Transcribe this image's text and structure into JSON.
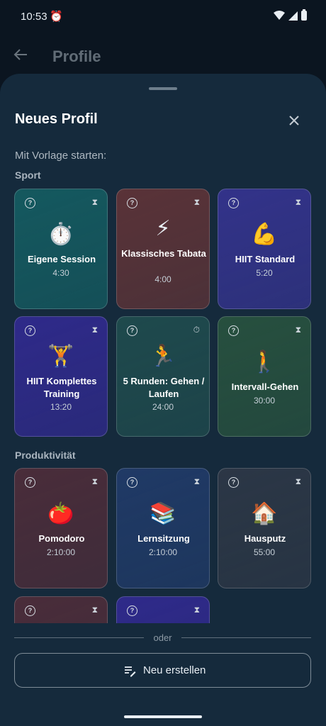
{
  "status": {
    "time": "10:53",
    "alarm_icon": "alarm-icon"
  },
  "appbar": {
    "title": "Profile"
  },
  "sheet": {
    "title": "Neues Profil",
    "subtitle": "Mit Vorlage starten:",
    "sections": [
      "Sport",
      "Produktivität"
    ]
  },
  "sport": [
    {
      "emoji": "⏱️",
      "name": "Eigene Session",
      "duration": "4:30",
      "color": "#15595f",
      "indicator": "hourglass"
    },
    {
      "emoji": "⚡",
      "name": "Klassisches Tabata",
      "duration": "4:00",
      "color": "#5a3338",
      "indicator": "hourglass"
    },
    {
      "emoji": "💪",
      "name": "HIIT Standard",
      "duration": "5:20",
      "color": "#33338a",
      "indicator": "hourglass"
    },
    {
      "emoji": "🏋️",
      "name": "HIIT Komplettes Training",
      "duration": "13:20",
      "color": "#2f2a8a",
      "indicator": "hourglass"
    },
    {
      "emoji": "🏃",
      "name": "5 Runden: Gehen / Laufen",
      "duration": "24:00",
      "color": "#1f4a4d",
      "indicator": "stopwatch"
    },
    {
      "emoji": "🚶",
      "name": "Intervall-Gehen",
      "duration": "30:00",
      "color": "#27503f",
      "indicator": "hourglass"
    }
  ],
  "productivity": [
    {
      "emoji": "🍅",
      "name": "Pomodoro",
      "duration": "2:10:00",
      "color": "#4a2d3a",
      "indicator": "hourglass"
    },
    {
      "emoji": "📚",
      "name": "Lernsitzung",
      "duration": "2:10:00",
      "color": "#203a66",
      "indicator": "hourglass"
    },
    {
      "emoji": "🏠",
      "name": "Hausputz",
      "duration": "55:00",
      "color": "#2c3746",
      "indicator": "hourglass"
    }
  ],
  "partial_cards": [
    {
      "color": "#4a2d3a",
      "indicator": "hourglass"
    },
    {
      "color": "#2f2a8a",
      "indicator": "hourglass"
    }
  ],
  "divider_text": "oder",
  "new_button": {
    "label": "Neu erstellen",
    "icon": "edit-list-icon"
  }
}
